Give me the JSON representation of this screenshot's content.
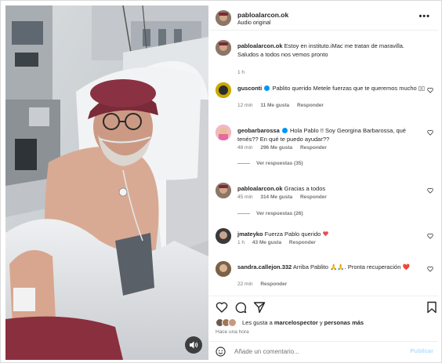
{
  "post": {
    "username": "pabloalarcon.ok",
    "audio": "Audio original",
    "more_label": "•••"
  },
  "caption": {
    "username": "pabloalarcon.ok",
    "text": "Estoy en instituto.iMac me tratan de maravilla. Saludos a todos nos vemos pronto",
    "time": "1 h"
  },
  "comments": [
    {
      "username": "gusconti",
      "verified": true,
      "text": "Pablito querido Metele fuerzas que te queremos mucho ",
      "emoji_tail": "▯▯",
      "time": "12 min",
      "likes": "11 Me gusta",
      "reply": "Responder"
    },
    {
      "username": "geobarbarossa",
      "verified": true,
      "text": "Hola Pablo !! Soy Georgina Barbarossa, qué tenés?? En qué te puedo ayudar??",
      "time": "48 min",
      "likes": "296 Me gusta",
      "reply": "Responder",
      "view_replies": "Ver respuestas (35)"
    },
    {
      "username": "pabloalarcon.ok",
      "verified": false,
      "text": "Gracias a todos",
      "time": "45 min",
      "likes": "314 Me gusta",
      "reply": "Responder",
      "view_replies": "Ver respuestas (26)"
    },
    {
      "username": "jmateyko",
      "verified": false,
      "text": "Fuerza Pablo querido",
      "time": "1 h",
      "likes": "43 Me gusta",
      "reply": "Responder"
    },
    {
      "username": "sandra.callejon.332",
      "verified": false,
      "text": "Arriba Pablito 🙏🙏. Pronta recuperación ❤️",
      "time": "22 min",
      "likes": "",
      "reply": "Responder"
    }
  ],
  "likes_summary": {
    "prefix": "Les gusta a ",
    "user": "marcelospector",
    "suffix": " y ",
    "others": "personas más"
  },
  "time_ago": "Hace una hora",
  "add_comment": {
    "placeholder": "Añade un comentario...",
    "publish": "Publicar"
  },
  "icons": [
    "heart-icon",
    "comment-icon",
    "share-icon",
    "bookmark-icon",
    "emoji-icon",
    "volume-icon",
    "more-icon"
  ],
  "colors": {
    "text": "#262626",
    "muted": "#737373",
    "link_blue": "#0095f6",
    "publish_disabled": "#b2dffc",
    "heart_red": "#ed4956"
  }
}
